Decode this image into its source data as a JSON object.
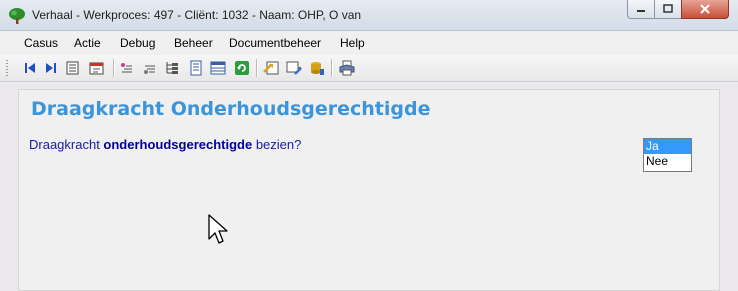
{
  "window": {
    "title": "Verhaal - Werkproces: 497 - Cliënt: 1032 - Naam: OHP, O van"
  },
  "menu": {
    "items": [
      "Casus",
      "Actie",
      "Debug",
      "Beheer",
      "Documentbeheer",
      "Help"
    ]
  },
  "toolbar": {
    "buttons": [
      "first-icon",
      "next-icon",
      "list-icon",
      "edit-form-icon",
      "sort-asc-icon",
      "sort-desc-icon",
      "tree-icon",
      "document-icon",
      "table-icon",
      "refresh-icon",
      "import-icon",
      "export-icon",
      "database-icon",
      "print-icon"
    ]
  },
  "page": {
    "title": "Draagkracht Onderhoudsgerechtigde",
    "question_pre": "Draagkracht ",
    "question_bold": "onderhoudsgerechtigde",
    "question_post": " bezien?",
    "answers": [
      "Ja",
      "Nee"
    ],
    "selected_answer": "Ja"
  },
  "colors": {
    "title": "#3c94dc",
    "question": "#1a1aa8",
    "selection": "#3399ff"
  }
}
